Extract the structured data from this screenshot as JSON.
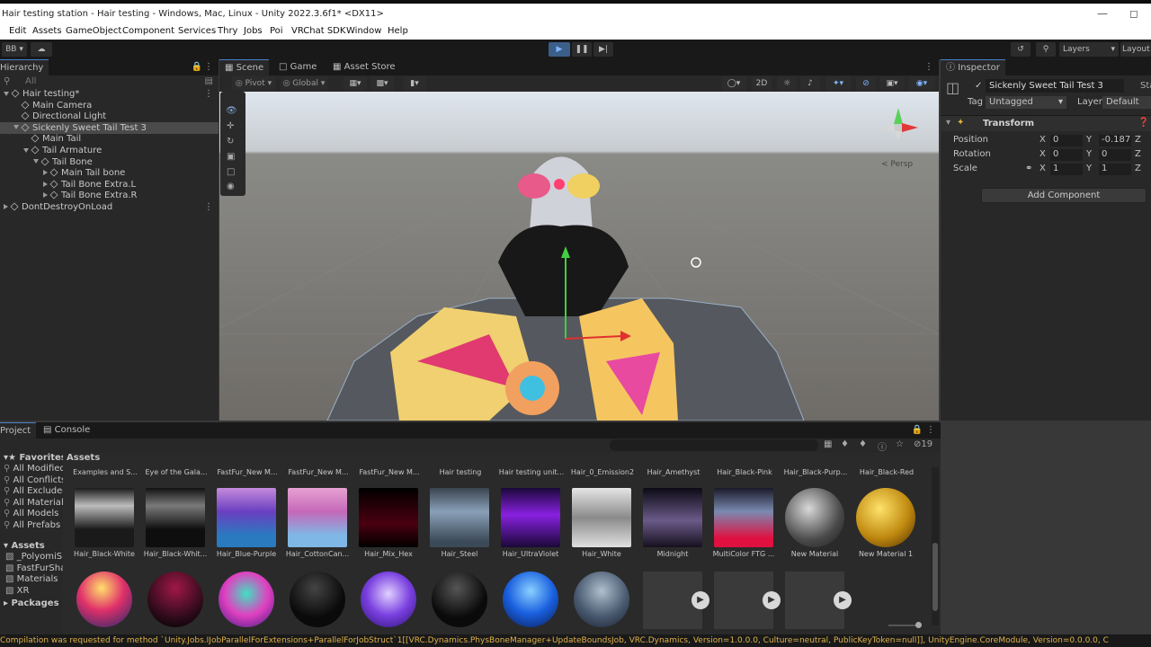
{
  "window": {
    "title": "Hair testing station - Hair testing - Windows, Mac, Linux - Unity 2022.3.6f1* <DX11>"
  },
  "menu": [
    "Edit",
    "Assets",
    "GameObject",
    "Component",
    "Services",
    "Thry",
    "Jobs",
    "Poi",
    "VRChat SDK",
    "Window",
    "Help"
  ],
  "toolbar": {
    "account": "BB",
    "layers_label": "Layers",
    "layout_label": "Layout"
  },
  "hierarchy": {
    "tab": "Hierarchy",
    "search_placeholder": "All",
    "rows": [
      {
        "label": "Hair testing*",
        "indent": 0,
        "kind": "scene",
        "expand": "down"
      },
      {
        "label": "Main Camera",
        "indent": 1,
        "kind": "obj"
      },
      {
        "label": "Directional Light",
        "indent": 1,
        "kind": "obj"
      },
      {
        "label": "Sickenly Sweet Tail Test 3",
        "indent": 1,
        "kind": "obj",
        "expand": "down",
        "selected": true
      },
      {
        "label": "Main Tail",
        "indent": 2,
        "kind": "obj"
      },
      {
        "label": "Tail Armature",
        "indent": 2,
        "kind": "obj",
        "expand": "down"
      },
      {
        "label": "Tail Bone",
        "indent": 3,
        "kind": "obj",
        "expand": "down"
      },
      {
        "label": "Main Tail bone",
        "indent": 4,
        "kind": "obj",
        "expand": "right"
      },
      {
        "label": "Tail Bone Extra.L",
        "indent": 4,
        "kind": "obj",
        "expand": "right"
      },
      {
        "label": "Tail Bone Extra.R",
        "indent": 4,
        "kind": "obj",
        "expand": "right"
      },
      {
        "label": "DontDestroyOnLoad",
        "indent": 0,
        "kind": "scene",
        "expand": "right"
      }
    ]
  },
  "scene_tabs": [
    "Scene",
    "Game",
    "Asset Store"
  ],
  "scene_toolbar": {
    "pivot": "Pivot",
    "global": "Global",
    "mode2d": "2D",
    "persp": "< Persp"
  },
  "inspector": {
    "tab": "Inspector",
    "object_name": "Sickenly Sweet Tail Test 3",
    "static_label": "Sta",
    "tag_label": "Tag",
    "tag_value": "Untagged",
    "layer_label": "Layer",
    "layer_value": "Default",
    "component": "Transform",
    "rows": [
      {
        "label": "Position",
        "x": "0",
        "y": "-0.187",
        "z": "Z"
      },
      {
        "label": "Rotation",
        "x": "0",
        "y": "0",
        "z": "Z"
      },
      {
        "label": "Scale",
        "x": "1",
        "y": "1",
        "z": "Z"
      }
    ],
    "add_component": "Add Component"
  },
  "project": {
    "tabs": [
      "Project",
      "Console"
    ],
    "breadcrumb": "Assets",
    "hidden_count": "19",
    "favorites_title": "Favorites",
    "favorites": [
      "All Modified",
      "All Conflicts",
      "All Excluded",
      "All Materials",
      "All Models",
      "All Prefabs"
    ],
    "assets_title": "Assets",
    "asset_folders": [
      "_PolyomiSh",
      "FastFurShad",
      "Materials",
      "XR"
    ],
    "packages": "Packages",
    "top_row_labels": [
      "Examples and S...",
      "Eye of the Gala...",
      "FastFur_New M...",
      "FastFur_New M...",
      "FastFur_New M...",
      "Hair testing",
      "Hair testing unit...",
      "Hair_0_Emission2",
      "Hair_Amethyst",
      "Hair_Black-Pink",
      "Hair_Black-Purp...",
      "Hair_Black-Red"
    ],
    "row2_labels": [
      "Hair_Black-White",
      "Hair_Black-Whit...",
      "Hair_Blue-Purple",
      "Hair_CottonCan...",
      "Hair_Mix_Hex",
      "Hair_Steel",
      "Hair_UltraViolet",
      "Hair_White",
      "Midnight",
      "MultiColor FTG ...",
      "New Material",
      "New Material 1"
    ],
    "row2_colors": [
      "linear-gradient(#1a1a1a,#bdbdbd 30%,#1a1a1a 70%)",
      "linear-gradient(#111,#7a7a7a 30%,#0e0e0e 70%)",
      "linear-gradient(#c48adc,#6a3fc0 40%,#2a7ac0 80%)",
      "linear-gradient(#e7a2d2,#c468b8 40%,#7fb8e6 80%)",
      "linear-gradient(#000,#4a0010 60%,#000)",
      "linear-gradient(#3a4450,#8aa0b8 40%,#3c4a58 90%)",
      "linear-gradient(#1a0838,#8820e0 45%,#1a0838)",
      "linear-gradient(#e6e6e6,#8a8a8a 50%,#e0e0e0)",
      "linear-gradient(#0c0a14,#6a5a88 55%,#15101e)",
      "linear-gradient(#1a1a2a,#7a8ab0 40%,#e01040 85%)",
      "radial-gradient(circle at 40% 35%,#d8d8d8,#4a4a4a 60%,#1a1a1a)",
      "radial-gradient(circle at 40% 35%,#ffe26a,#c08a10 55%,#4a2a00)"
    ],
    "row3_colors": [
      "radial-gradient(circle at 45% 30%,#ffe06a,#e0306a 45%,#1a2a6a)",
      "radial-gradient(circle at 50% 30%,#a01848,#2a0a18 65%,#000)",
      "radial-gradient(circle at 50% 40%,#40e0c0,#e040c0 50%,#3a1a80)",
      "radial-gradient(circle at 45% 30%,#444,#0a0a0a 60%)",
      "radial-gradient(circle at 50% 40%,#e0d0ff,#7a40e0 50%,#2a1070)",
      "radial-gradient(circle at 45% 30%,#555,#0a0a0a 60%)",
      "radial-gradient(circle at 50% 35%,#8ad0ff,#1a60e0 50%,#0a1a50)",
      "radial-gradient(circle at 50% 35%,#b0c0d0,#4a5a70 55%,#1a2030)"
    ]
  },
  "status": "Compilation was requested for method `Unity.Jobs.IJobParallelForExtensions+ParallelForJobStruct`1[[VRC.Dynamics.PhysBoneManager+UpdateBoundsJob, VRC.Dynamics, Version=1.0.0.0, Culture=neutral, PublicKeyToken=null]], UnityEngine.CoreModule, Version=0.0.0.0, C"
}
